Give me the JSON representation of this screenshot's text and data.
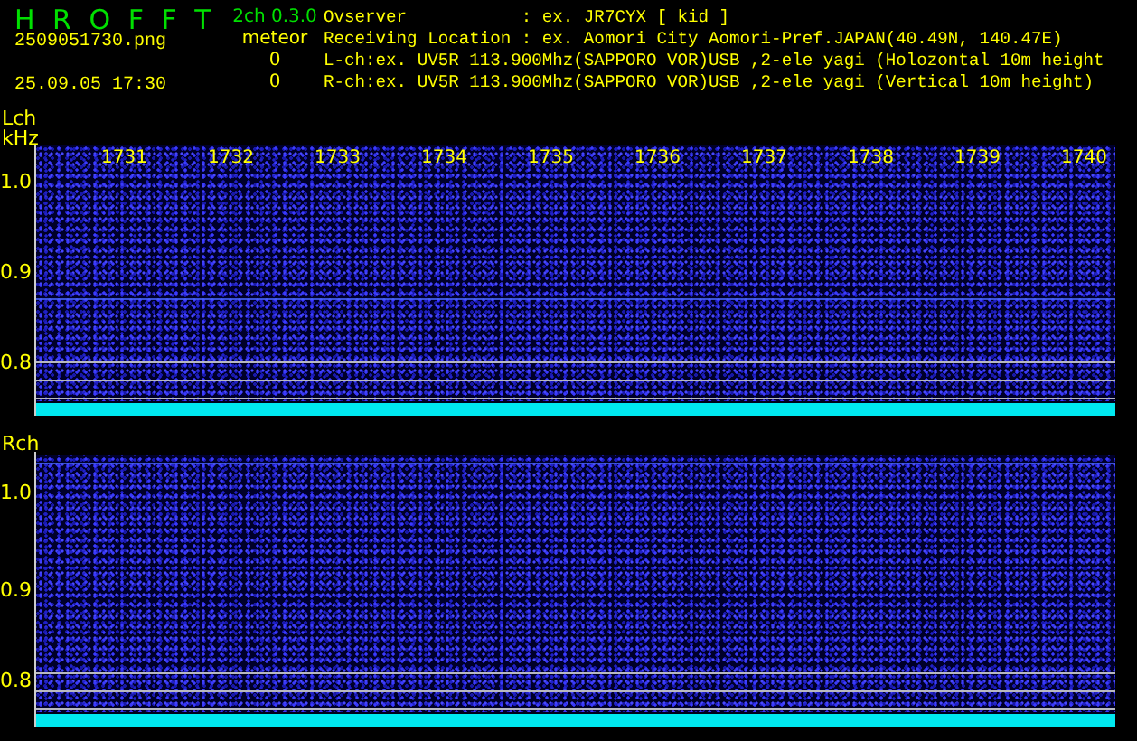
{
  "header": {
    "app_name": "H R O F F T",
    "version": "2ch 0.3.0",
    "filename": "2509051730.png",
    "datetime": "25.09.05 17:30",
    "meteor_label": "meteor",
    "meteor_counts": [
      "0",
      "0"
    ],
    "info_lines": [
      "Ovserver           : ex. JR7CYX [ kid ]",
      "Receiving Location : ex. Aomori City Aomori-Pref.JAPAN(40.49N, 140.47E)",
      "L-ch:ex. UV5R 113.900Mhz(SAPPORO VOR)USB ,2-ele yagi (Holozontal 10m height",
      "R-ch:ex. UV5R 113.900Mhz(SAPPORO VOR)USB ,2-ele yagi (Vertical 10m height)"
    ]
  },
  "channels": [
    {
      "label": "Lch",
      "unit": "kHz",
      "x_labels": [
        "1731",
        "1732",
        "1733",
        "1734",
        "1735",
        "1736",
        "1737",
        "1738",
        "1739",
        "1740"
      ],
      "y_labels": [
        "1.0",
        "0.9",
        "0.8"
      ]
    },
    {
      "label": "Rch",
      "y_labels": [
        "1.0",
        "0.9",
        "0.8"
      ]
    }
  ]
}
